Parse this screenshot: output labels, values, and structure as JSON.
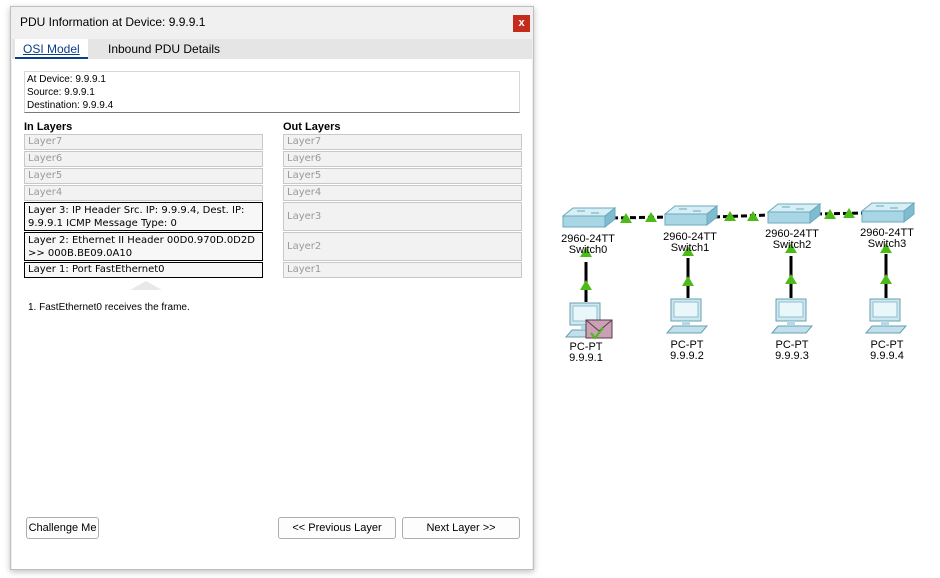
{
  "dialog": {
    "title": "PDU Information at Device: 9.9.9.1",
    "close_glyph": "x",
    "tabs": [
      {
        "label": "OSI Model",
        "active": true
      },
      {
        "label": "Inbound PDU Details",
        "active": false
      }
    ],
    "info": {
      "at_device": "At Device: 9.9.9.1",
      "source": "Source: 9.9.9.1",
      "destination": "Destination: 9.9.9.4"
    },
    "in_layers_header": "In Layers",
    "out_layers_header": "Out Layers",
    "in_layers": [
      "Layer7",
      "Layer6",
      "Layer5",
      "Layer4",
      "Layer 3: IP Header Src. IP: 9.9.9.4, Dest. IP: 9.9.9.1 ICMP Message Type: 0",
      "Layer 2: Ethernet II Header 00D0.970D.0D2D >> 000B.BE09.0A10",
      "Layer 1: Port FastEthernet0"
    ],
    "out_layers": [
      "Layer7",
      "Layer6",
      "Layer5",
      "Layer4",
      "Layer3",
      "Layer2",
      "Layer1"
    ],
    "step_text": "1. FastEthernet0 receives the frame.",
    "buttons": {
      "challenge": "Challenge Me",
      "previous": "<< Previous Layer",
      "next": "Next Layer >>"
    }
  },
  "topology": {
    "switches": [
      {
        "model": "2960-24TT",
        "name": "Switch0"
      },
      {
        "model": "2960-24TT",
        "name": "Switch1"
      },
      {
        "model": "2960-24TT",
        "name": "Switch2"
      },
      {
        "model": "2960-24TT",
        "name": "Switch3"
      }
    ],
    "pcs": [
      {
        "type": "PC-PT",
        "ip": "9.9.9.1"
      },
      {
        "type": "PC-PT",
        "ip": "9.9.9.2"
      },
      {
        "type": "PC-PT",
        "ip": "9.9.9.3"
      },
      {
        "type": "PC-PT",
        "ip": "9.9.9.4"
      }
    ],
    "colors": {
      "link_up": "#4cbb17",
      "cable": "#000000",
      "switch_face": "#a9d6e5",
      "envelope": "#c9a0b4"
    }
  }
}
